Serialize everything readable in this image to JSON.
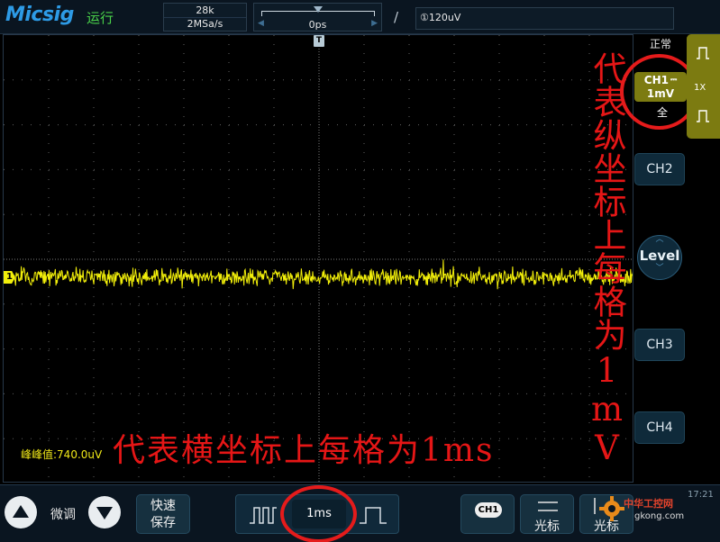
{
  "header": {
    "brand": "Micsig",
    "run_status": "运行",
    "memory_depth": "28k",
    "sample_rate": "2MSa/s",
    "time_position": "0ps",
    "trigger_level": "①120uV"
  },
  "screen": {
    "trigger_marker": "T",
    "ch1_marker": "1",
    "peak_to_peak": "峰峰值:740.0uV",
    "annotation_horizontal": "代表横坐标上每格为1ms",
    "annotation_vertical": "代表纵坐标上每格为1mV"
  },
  "right_panel": {
    "trigger_mode": "正常",
    "ch1_name": "CH1",
    "ch1_coupling_icon": "dc-coupling-icon",
    "ch1_scale": "1mV",
    "bandwidth": "全",
    "probe": "1X",
    "ch2": "CH2",
    "level": "Level",
    "ch3": "CH3",
    "ch4": "CH4"
  },
  "footer": {
    "fine_adjust": "微调",
    "save_line1": "快速",
    "save_line2": "保存",
    "timebase": "1ms",
    "channel_chip": "CH1",
    "cursor1": "光标",
    "cursor2": "光标",
    "clock": "17:21",
    "watermark_name": "中华工控网",
    "watermark_domain": "gkong.com"
  },
  "colors": {
    "trace": "#f2ef0a",
    "annotation": "#e51616",
    "brand": "#2d9be6",
    "run_status": "#49d24a",
    "ch1_card": "#7c7b11"
  }
}
